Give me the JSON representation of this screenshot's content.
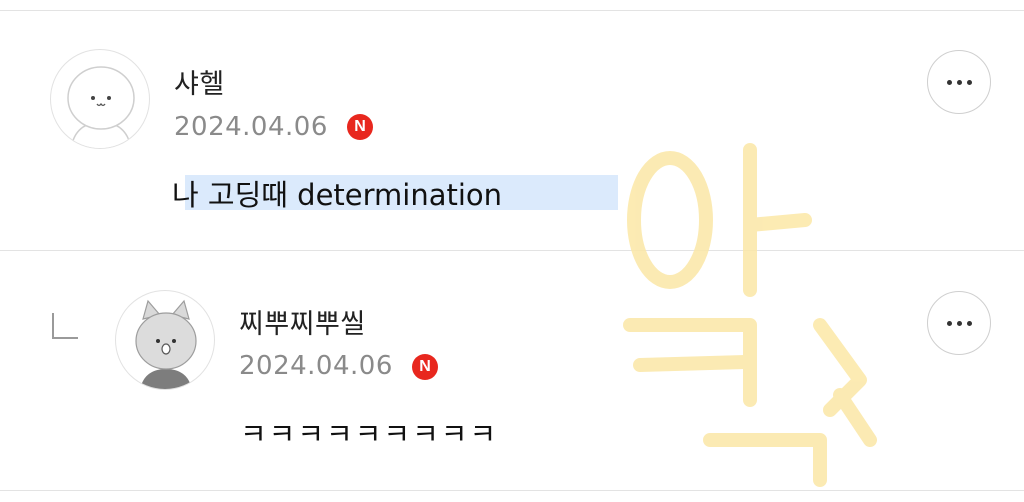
{
  "comments": [
    {
      "author": "샤헬",
      "date": "2024.04.06",
      "badge": "N",
      "text": "나 고딩때 determination",
      "avatar": "bear-avatar-icon"
    }
  ],
  "replies": [
    {
      "author": "찌뿌찌뿌씰",
      "date": "2024.04.06",
      "badge": "N",
      "text": "ㅋㅋㅋㅋㅋㅋㅋㅋㅋ",
      "avatar": "cat-avatar-icon"
    }
  ],
  "icons": {
    "more": "more-options-icon",
    "reply": "reply-arrow-icon",
    "new": "new-badge-icon"
  },
  "colors": {
    "badge_red": "#e8271e",
    "highlight": "#dbeafc",
    "divider": "#e3e3e3",
    "watermark": "#fbe7a6"
  }
}
